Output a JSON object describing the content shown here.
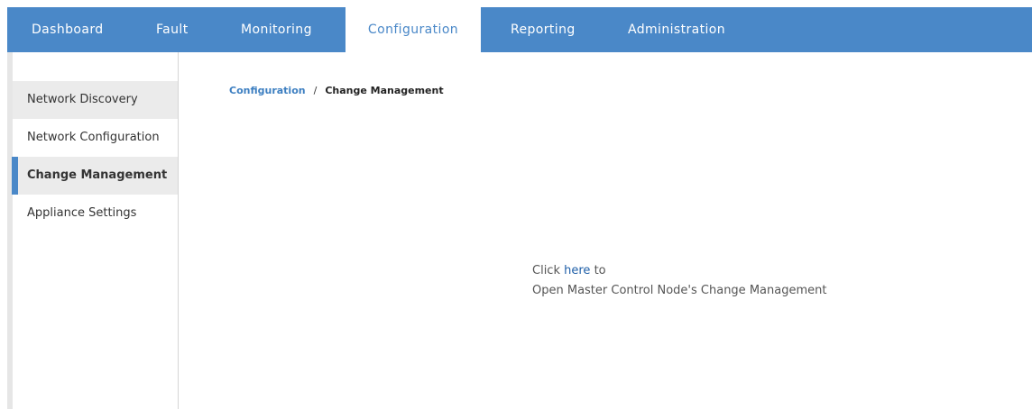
{
  "nav": {
    "tabs": [
      {
        "label": "Dashboard"
      },
      {
        "label": "Fault"
      },
      {
        "label": "Monitoring"
      },
      {
        "label": "Configuration"
      },
      {
        "label": "Reporting"
      },
      {
        "label": "Administration"
      }
    ],
    "active_tab": "Configuration"
  },
  "sidebar": {
    "items": [
      {
        "label": "Network Discovery"
      },
      {
        "label": "Network Configuration"
      },
      {
        "label": "Change Management"
      },
      {
        "label": "Appliance Settings"
      }
    ],
    "active_item": "Change Management"
  },
  "breadcrumb": {
    "parent": "Configuration",
    "separator": "/",
    "current": "Change Management"
  },
  "message": {
    "prefix": "Click",
    "link": "here",
    "suffix": "to",
    "line2": "Open Master Control Node's Change Management"
  },
  "colors": {
    "accent": "#4a88c8",
    "link": "#1f5fa8",
    "sidebar_highlight": "#ebebeb"
  }
}
